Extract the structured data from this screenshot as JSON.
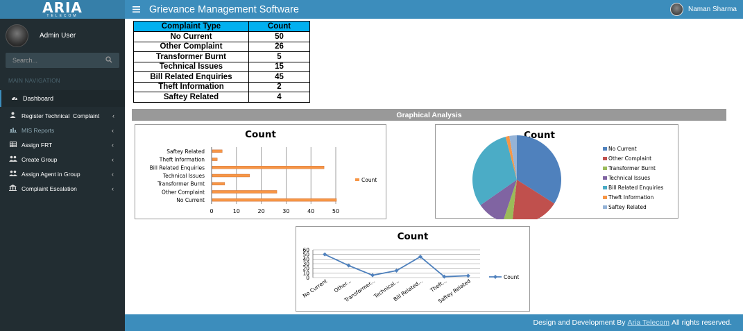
{
  "app": {
    "logo": "ARIA",
    "logo_sub": "TELECOM",
    "title": "Grievance Management Software",
    "header_user": "Naman Sharma"
  },
  "sidebar": {
    "user_name": "Admin User",
    "search_placeholder": "Search...",
    "nav_header": "MAIN NAVIGATION",
    "items": [
      {
        "label": "Dashboard",
        "icon": "dashboard-icon"
      },
      {
        "label": "Register Technical  Complaint",
        "icon": "user-icon"
      },
      {
        "label": "MIS Reports",
        "icon": "bar-chart-icon"
      },
      {
        "label": "Assign FRT",
        "icon": "table-icon"
      },
      {
        "label": "Create Group",
        "icon": "group-icon"
      },
      {
        "label": "Assign Agent in Group",
        "icon": "group-icon"
      },
      {
        "label": "Complaint Escalation",
        "icon": "bank-icon"
      }
    ]
  },
  "table": {
    "headers": [
      "Complaint Type",
      "Count"
    ],
    "rows": [
      [
        "No Current",
        "50"
      ],
      [
        "Other Complaint",
        "26"
      ],
      [
        "Transformer Burnt",
        "5"
      ],
      [
        "Technical Issues",
        "15"
      ],
      [
        "Bill Related Enquiries",
        "45"
      ],
      [
        "Theft Information",
        "2"
      ],
      [
        "Saftey Related",
        "4"
      ]
    ]
  },
  "section_title": "Graphical Analysis",
  "chart_data": [
    {
      "type": "bar",
      "title": "Count",
      "orientation": "horizontal",
      "categories": [
        "No Current",
        "Other Complaint",
        "Transformer Burnt",
        "Technical Issues",
        "Bill Related Enquiries",
        "Theft Information",
        "Saftey Related"
      ],
      "series": [
        {
          "name": "Count",
          "values": [
            50,
            26,
            5,
            15,
            45,
            2,
            4
          ]
        }
      ],
      "xticks": [
        0,
        10,
        20,
        30,
        40,
        50
      ],
      "xlim": [
        0,
        50
      ],
      "grid": true,
      "legend": "right",
      "color": "#f79646"
    },
    {
      "type": "pie",
      "title": "Count",
      "categories": [
        "No Current",
        "Other Complaint",
        "Transformer Burnt",
        "Technical Issues",
        "Bill Related Enquiries",
        "Theft Information",
        "Saftey Related"
      ],
      "values": [
        50,
        26,
        5,
        15,
        45,
        2,
        4
      ],
      "colors": [
        "#4f81bd",
        "#c0504d",
        "#9bbb59",
        "#8064a2",
        "#4bacc6",
        "#f79646",
        "#95b3d7"
      ],
      "legend": "right"
    },
    {
      "type": "line",
      "title": "Count",
      "categories": [
        "No Current",
        "Other...",
        "Transformer...",
        "Technical...",
        "Bill Related...",
        "Theft...",
        "Saftey Related"
      ],
      "series": [
        {
          "name": "Count",
          "values": [
            50,
            26,
            5,
            15,
            45,
            2,
            4
          ]
        }
      ],
      "yticks": [
        0,
        10,
        20,
        30,
        40,
        50,
        60
      ],
      "ylim": [
        0,
        60
      ],
      "grid": true,
      "legend": "right",
      "color": "#4f81bd"
    }
  ],
  "footer": {
    "prefix": "Design and Development By",
    "link": "Aria Telecom",
    "suffix": "All rights reserved."
  }
}
